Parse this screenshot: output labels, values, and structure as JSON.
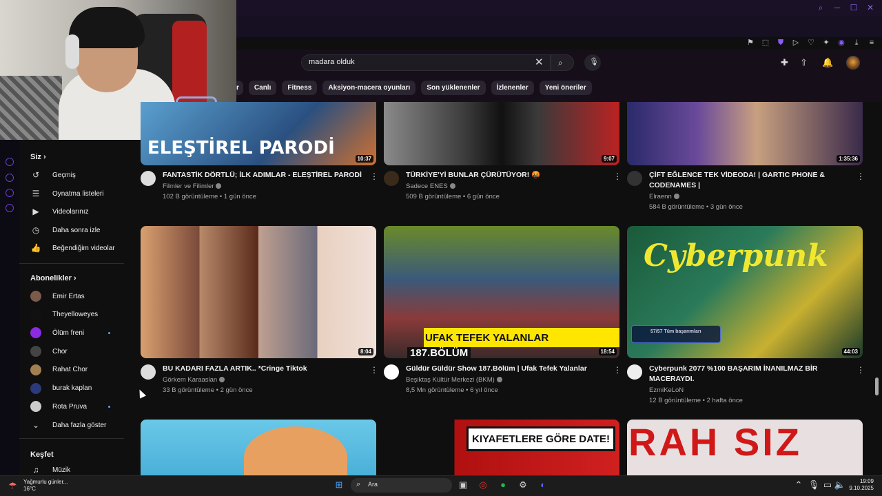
{
  "header": {
    "search_value": "madara olduk",
    "chips": [
      "Canlı",
      "Fitness",
      "Aksiyon-macera oyunları",
      "Son yüklenenler",
      "İzlenenler",
      "Yeni öneriler"
    ]
  },
  "sidebar": {
    "you_title": "Siz",
    "you_items": [
      {
        "label": "Geçmiş",
        "icon": "history-icon"
      },
      {
        "label": "Oynatma listeleri",
        "icon": "playlist-icon"
      },
      {
        "label": "Videolarınız",
        "icon": "your-videos-icon"
      },
      {
        "label": "Daha sonra izle",
        "icon": "watch-later-icon"
      },
      {
        "label": "Beğendiğim videolar",
        "icon": "like-icon"
      }
    ],
    "subs_title": "Abonelikler",
    "subs": [
      {
        "label": "Emir Ertas",
        "live": false,
        "color": "#7a5a4a"
      },
      {
        "label": "Theyelloweyes",
        "live": false,
        "color": "#111111"
      },
      {
        "label": "Ölüm freni",
        "live": true,
        "color": "#8a2be2"
      },
      {
        "label": "Chor",
        "live": false,
        "color": "#444444"
      },
      {
        "label": "Rahat Chor",
        "live": false,
        "color": "#a08050"
      },
      {
        "label": "burak kaplan",
        "live": false,
        "color": "#2a3a7a"
      },
      {
        "label": "Rota Pruva",
        "live": true,
        "color": "#cccccc"
      }
    ],
    "show_more": "Daha fazla göster",
    "explore_title": "Keşfet",
    "explore_items": [
      {
        "label": "Müzik",
        "icon": "music-icon"
      }
    ]
  },
  "videos": [
    {
      "title": "FANTASTİK DÖRTLÜ; İLK ADIMLAR - ELEŞTİREL PARODİ",
      "channel": "Filmler ve Filimler",
      "meta": "102 B görüntüleme • 1 gün önce",
      "duration": "10:37",
      "thumb_text": "ELEŞTİREL PARODİ"
    },
    {
      "title": "TÜRKİYE'Yİ BUNLAR ÇÜRÜTÜYOR! 🤬",
      "channel": "Sadece ENES",
      "meta": "509 B görüntüleme • 6 gün önce",
      "duration": "9:07"
    },
    {
      "title": "ÇİFT EĞLENCE TEK VİDEODA! | GARTIC PHONE & CODENAMES |",
      "channel": "Elraenn",
      "meta": "584 B görüntüleme • 3 gün önce",
      "duration": "1:35:36"
    },
    {
      "title": "BU KADARI FAZLA ARTIK.. *Cringe Tiktok",
      "channel": "Görkem Karaaslan",
      "meta": "33 B görüntüleme • 2 gün önce",
      "duration": "8:04"
    },
    {
      "title": "Güldür Güldür Show 187.Bölüm | Ufak Tefek Yalanlar",
      "channel": "Beşiktaş Kültür Merkezi (BKM)",
      "meta": "8,5 Mn görüntüleme • 6 yıl önce",
      "duration": "18:54",
      "thumb_text": "UFAK TEFEK YALANLAR",
      "thumb_text2": "187.BÖLÜM"
    },
    {
      "title": "Cyberpunk 2077 %100 BAŞARIM İNANILMAZ BİR MACERAYDI.",
      "channel": "EzmiKeLoN",
      "meta": "12 B görüntüleme • 2 hafta önce",
      "duration": "44:03",
      "thumb_text": "Cyberpunk",
      "thumb_text2": "57/57 Tüm başarımları"
    },
    {
      "title": "",
      "channel": "",
      "meta": ""
    },
    {
      "title": "",
      "channel": "",
      "meta": "",
      "thumb_text": "KIYAFETLERE GÖRE DATE!"
    },
    {
      "title": "",
      "channel": "",
      "meta": "",
      "thumb_text": "RAH  SIZ"
    }
  ],
  "taskbar": {
    "weather_line1": "Yağmurlu günler...",
    "weather_line2": "16°C",
    "search_label": "Ara",
    "time": "19:09",
    "date": "9.10.2025"
  },
  "colors": {
    "accent": "#8a5cf6",
    "bg": "#0f0f0f",
    "header_bg": "#160f1a"
  }
}
